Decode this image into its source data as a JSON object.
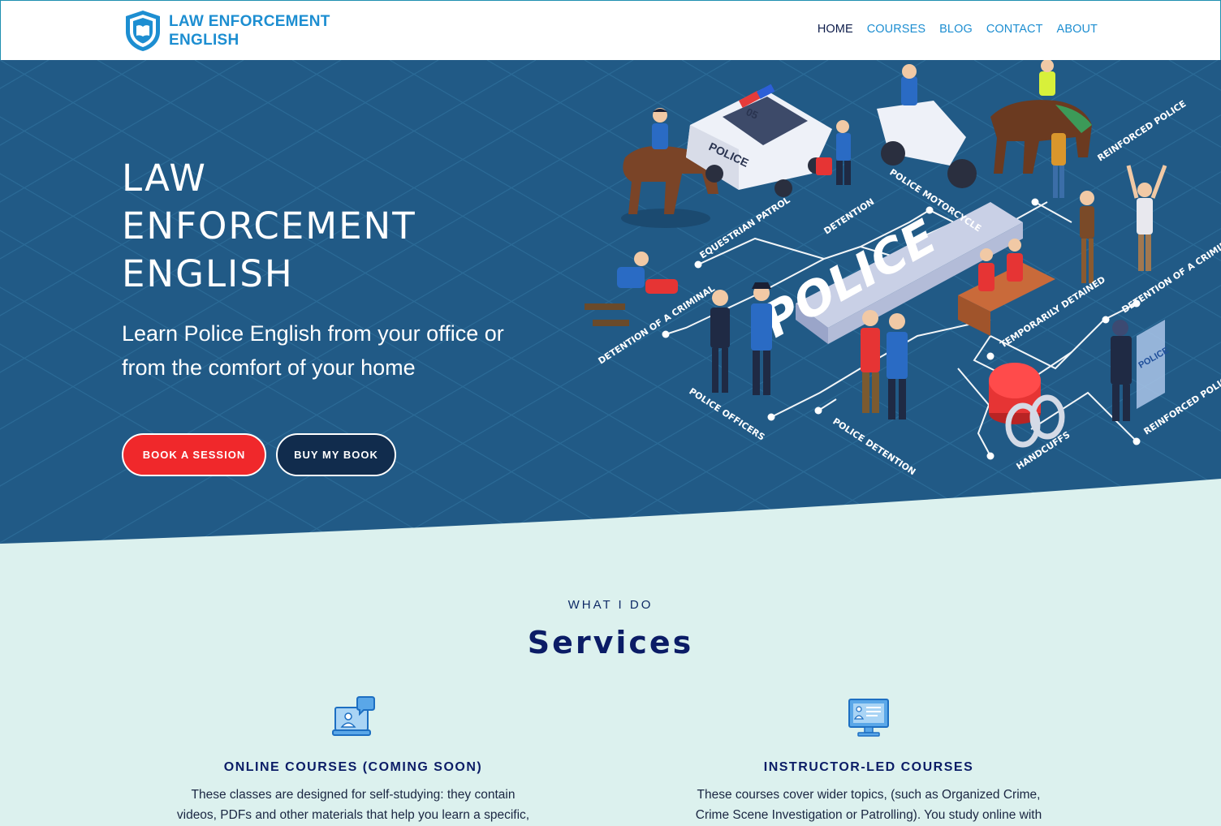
{
  "brand": {
    "line1": "LAW ENFORCEMENT",
    "line2": "ENGLISH",
    "logo_icon": "shield-book-icon",
    "color": "#1d8ed1"
  },
  "nav": {
    "items": [
      {
        "label": "HOME",
        "active": true
      },
      {
        "label": "COURSES",
        "active": false
      },
      {
        "label": "BLOG",
        "active": false
      },
      {
        "label": "CONTACT",
        "active": false
      },
      {
        "label": "ABOUT",
        "active": false
      }
    ]
  },
  "hero": {
    "title_lines": [
      "LAW",
      "ENFORCEMENT",
      "ENGLISH"
    ],
    "subtitle": "Learn Police English from your office or from the comfort of your home",
    "buttons": {
      "book": "BOOK A SESSION",
      "buy": "BUY MY BOOK"
    },
    "illustration": {
      "center_text": "POLICE",
      "labels": {
        "equestrian": "EQUESTRIAN PATROL",
        "detention": "DETENTION",
        "motorcycle": "POLICE MOTORCYCLE",
        "reinforced_top": "REINFORCED POLICE",
        "criminal_left": "DETENTION OF A CRIMINAL",
        "officers": "POLICE OFFICERS",
        "police_detention": "POLICE DETENTION",
        "temp": "TEMPORARILY DETAINED",
        "handcuffs": "HANDCUFFS",
        "criminal_right": "DETENTION OF A CRIMINAL",
        "reinforced_bottom": "REINFORCED POLICE",
        "car_roof": "05",
        "car_door": "POLICE",
        "shield": "POLICE"
      }
    },
    "colors": {
      "background": "#215a86",
      "book_button": "#f0282b",
      "buy_button": "#112c4d"
    }
  },
  "services": {
    "eyebrow": "WHAT I DO",
    "title": "Services",
    "items": [
      {
        "icon": "laptop-chat-icon",
        "title": "ONLINE COURSES (COMING SOON)",
        "text_line1": "These classes are designed for self-studying: they contain",
        "text_line2": "videos, PDFs and other materials that help you learn a specific,"
      },
      {
        "icon": "presentation-monitor-icon",
        "title": "INSTRUCTOR-LED COURSES",
        "text_line1": "These courses cover wider topics, (such as Organized Crime,",
        "text_line2": "Crime Scene Investigation or Patrolling). You study online with"
      }
    ],
    "background": "#dcf1ee"
  }
}
